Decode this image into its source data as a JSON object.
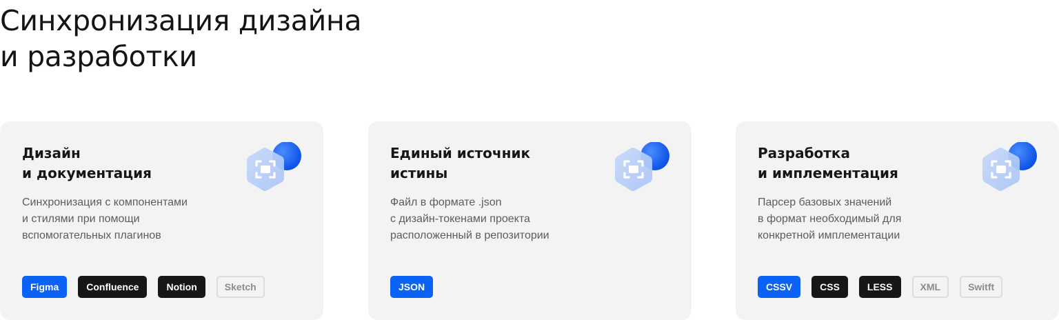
{
  "title": {
    "line1": "Синхронизация дизайна",
    "line2": "и разработки"
  },
  "colors": {
    "accent": "#0a63f5",
    "dark_tag": "#171717",
    "card_bg": "#f3f3f4"
  },
  "cards": [
    {
      "title_line1": "Дизайн",
      "title_line2": "и документация",
      "desc": [
        "Синхронизация с компонентами",
        "и стилями при помощи",
        "вспомогательных плагинов"
      ],
      "icon": "focus-frame-icon",
      "tags": [
        {
          "label": "Figma",
          "style": "blue"
        },
        {
          "label": "Confluence",
          "style": "dark"
        },
        {
          "label": "Notion",
          "style": "dark"
        },
        {
          "label": "Sketch",
          "style": "ghost"
        }
      ]
    },
    {
      "title_line1": "Единый источник",
      "title_line2": "истины",
      "desc": [
        "Файл в формате .json",
        "с дизайн-токенами проекта",
        "расположенный в репозитории"
      ],
      "icon": "focus-frame-icon",
      "tags": [
        {
          "label": "JSON",
          "style": "blue"
        }
      ]
    },
    {
      "title_line1": "Разработка",
      "title_line2": "и имплементация",
      "desc": [
        "Парсер базовых значений",
        "в формат необходимый для",
        "конкретной имплементации"
      ],
      "icon": "focus-frame-icon",
      "tags": [
        {
          "label": "CSSV",
          "style": "blue"
        },
        {
          "label": "CSS",
          "style": "dark"
        },
        {
          "label": "LESS",
          "style": "dark"
        },
        {
          "label": "XML",
          "style": "ghost"
        },
        {
          "label": "Switft",
          "style": "ghost"
        }
      ]
    }
  ]
}
